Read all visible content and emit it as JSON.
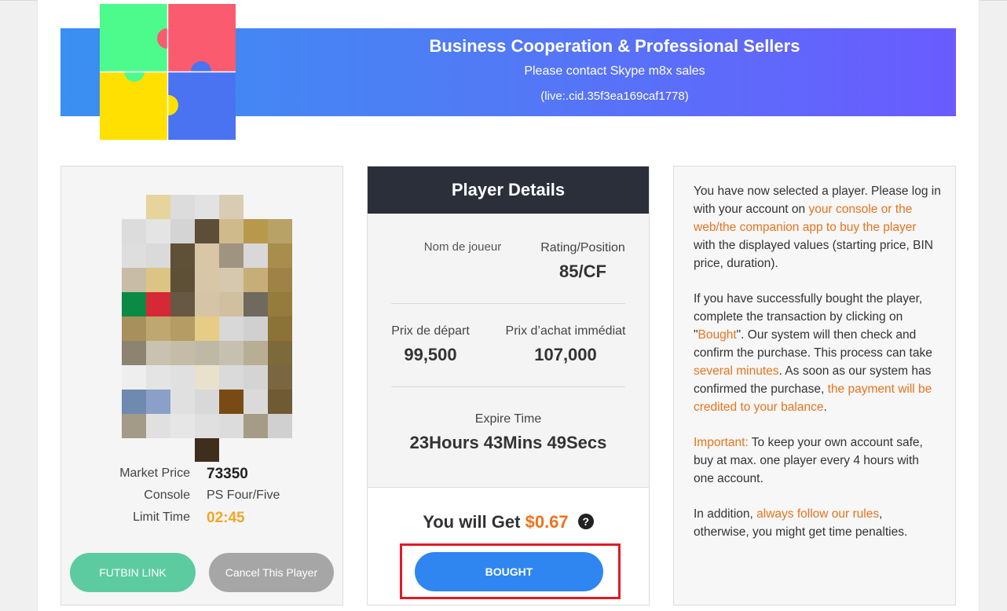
{
  "banner": {
    "title": "Business Cooperation & Professional Sellers",
    "subtitle": "Please contact Skype m8x sales",
    "contact_id": "(live:.cid.35f3ea169caf1778)"
  },
  "player_card": {
    "market_price_label": "Market Price",
    "market_price_value": "73350",
    "console_label": "Console",
    "console_value": "PS Four/Five",
    "limit_time_label": "Limit Time",
    "limit_time_value": "02:45",
    "futbin_button": "FUTBIN LINK",
    "cancel_button": "Cancel This Player"
  },
  "player_details": {
    "header": "Player Details",
    "name_label": "Nom de joueur",
    "name_value": "",
    "rating_label": "Rating/Position",
    "rating_value": "85/CF",
    "start_price_label": "Prix de départ",
    "start_price_value": "99,500",
    "bin_price_label": "Prix d’achat immédiat",
    "bin_price_value": "107,000",
    "expire_label": "Expire Time",
    "expire_value": "23Hours 43Mins 49Secs",
    "get_prefix": "You will Get",
    "get_amount": "$0.67",
    "help_icon": "?",
    "bought_button": "BOUGHT"
  },
  "instructions": {
    "p1_a": "You have now selected a player. Please log in with your account on ",
    "p1_b": "your console or the web/the companion app to buy the player",
    "p1_c": " with the displayed values (starting price, BIN price, duration).",
    "p2_a": "If you have successfully bought the player, complete the transaction by clicking on \"",
    "p2_b": "Bought",
    "p2_c": "\". Our system will then check and confirm the purchase. This process can take ",
    "p2_d": "several minutes",
    "p2_e": ". As soon as our system has confirmed the purchase, ",
    "p2_f": "the payment will be credited to your balance",
    "p2_g": ".",
    "p3_a": "Important:",
    "p3_b": " To keep your own account safe, buy at max. one player every 4 hours with one account.",
    "p4_a": "In addition, ",
    "p4_b": "always follow our rules",
    "p4_c": ", otherwise, you might get time penalties."
  },
  "colors": {
    "accent_orange": "#e8731e",
    "bought_blue": "#2f86f0",
    "futbin_green": "#5ccba0",
    "highlight_red": "#e01b24",
    "limit_time_orange": "#f5a623"
  },
  "icons": {
    "logo": "puzzle-logo-icon",
    "help": "question-circle-icon",
    "player_image": "pixelated-player-image"
  }
}
